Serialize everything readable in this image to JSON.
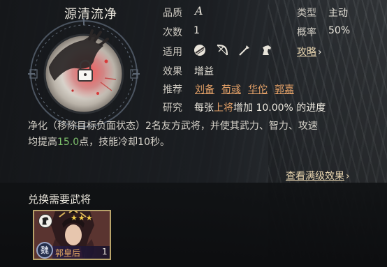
{
  "skill": {
    "name": "源清流净"
  },
  "attributes": {
    "quality_label": "品质",
    "quality_value": "A",
    "type_label": "类型",
    "type_value": "主动",
    "count_label": "次数",
    "count_value": "1",
    "rate_label": "概率",
    "rate_value": "50%",
    "suit_label": "适用",
    "suit_icons": [
      "shield-icon",
      "bow-icon",
      "spear-icon",
      "horse-icon"
    ],
    "strategy_label": "攻略",
    "effect_label": "效果",
    "effect_value": "增益",
    "recommend_label": "推荐",
    "recommend_names": [
      "刘备",
      "荀彧",
      "华佗",
      "郭嘉"
    ],
    "research_label": "研究",
    "research_prefix": "每张",
    "research_highlight": "上将",
    "research_suffix": "增加 10.00% 的进度"
  },
  "description": {
    "line1": "净化（移除目标负面状态）2名友方武将，并使其武力、智力、攻速",
    "line2_prefix": "均提高",
    "line2_number": "15.0",
    "line2_suffix": "点，技能冷却10秒。"
  },
  "full_effect_link": "查看满级效果",
  "exchange": {
    "title": "兑换需要武将",
    "general": {
      "stars": "★★★",
      "faction": "魏",
      "name": "郭皇后",
      "count": "1"
    }
  },
  "colors": {
    "accent_orange": "#e3a067",
    "green_number": "#7ec26d",
    "gold_border": "#b8a36a"
  }
}
